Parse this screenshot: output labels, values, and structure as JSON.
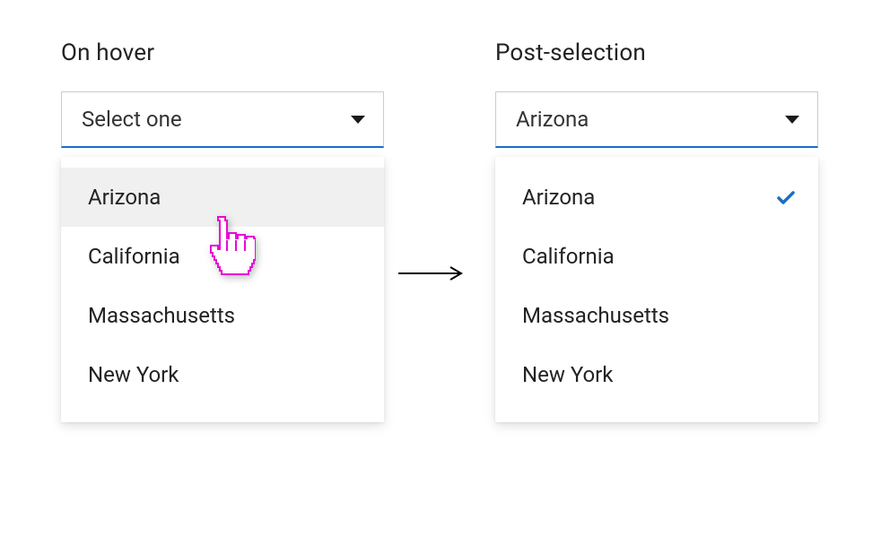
{
  "left": {
    "title": "On hover",
    "trigger": "Select one",
    "options": [
      {
        "label": "Arizona",
        "hovered": true,
        "selected": false
      },
      {
        "label": "California",
        "hovered": false,
        "selected": false
      },
      {
        "label": "Massachusetts",
        "hovered": false,
        "selected": false
      },
      {
        "label": "New York",
        "hovered": false,
        "selected": false
      }
    ]
  },
  "right": {
    "title": "Post-selection",
    "trigger": "Arizona",
    "options": [
      {
        "label": "Arizona",
        "hovered": false,
        "selected": true
      },
      {
        "label": "California",
        "hovered": false,
        "selected": false
      },
      {
        "label": "Massachusetts",
        "hovered": false,
        "selected": false
      },
      {
        "label": "New York",
        "hovered": false,
        "selected": false
      }
    ]
  },
  "colors": {
    "accent": "#1b6ec2",
    "cursor": "#e60bd3"
  }
}
